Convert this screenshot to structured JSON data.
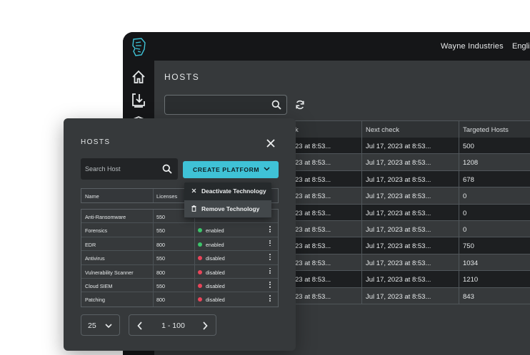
{
  "app": {
    "company": "Wayne Industries",
    "language": "Engli",
    "page_title": "HOSTS",
    "search_placeholder": "",
    "table": {
      "columns": [
        "k",
        "Next check",
        "Targeted Hosts"
      ],
      "rows": [
        {
          "last": "23 at 8:53...",
          "next": "Jul 17, 2023 at 8:53...",
          "hosts": "500"
        },
        {
          "last": "23 at 8:53...",
          "next": "Jul 17, 2023 at 8:53...",
          "hosts": "1208"
        },
        {
          "last": "23 at 8:53...",
          "next": "Jul 17, 2023 at 8:53...",
          "hosts": "678"
        },
        {
          "last": "23 at 8:53...",
          "next": "Jul 17, 2023 at 8:53...",
          "hosts": "0"
        },
        {
          "last": "23 at 8:53...",
          "next": "Jul 17, 2023 at 8:53...",
          "hosts": "0"
        },
        {
          "last": "23 at 8:53...",
          "next": "Jul 17, 2023 at 8:53...",
          "hosts": "0"
        },
        {
          "last": "23 at 8:53...",
          "next": "Jul 17, 2023 at 8:53...",
          "hosts": "750"
        },
        {
          "last": "23 at 8:53...",
          "next": "Jul 17, 2023 at 8:53...",
          "hosts": "1034"
        },
        {
          "last": "23 at 8:53...",
          "next": "Jul 17, 2023 at 8:53...",
          "hosts": "1210"
        },
        {
          "last": "23 at 8:53...",
          "next": "Jul 17, 2023 at 8:53...",
          "hosts": "843"
        }
      ]
    },
    "sidebar_icons": [
      "home-icon",
      "download-icon"
    ]
  },
  "modal": {
    "title": "HOSTS",
    "search_placeholder": "Search Host",
    "create_label": "CREATE PLATFORM",
    "columns": [
      "Name",
      "Licenses"
    ],
    "rows": [
      {
        "name": "Anti-Ransomware",
        "licenses": "550",
        "status": "",
        "status_color": ""
      },
      {
        "name": "Forensics",
        "licenses": "550",
        "status": "enabled",
        "status_color": "#3cc46a"
      },
      {
        "name": "EDR",
        "licenses": "800",
        "status": "enabled",
        "status_color": "#3cc46a"
      },
      {
        "name": "Antivirus",
        "licenses": "550",
        "status": "disabled",
        "status_color": "#e8455a"
      },
      {
        "name": "Vulnerability Scanner",
        "licenses": "800",
        "status": "disabled",
        "status_color": "#e8455a"
      },
      {
        "name": "Cloud SIEM",
        "licenses": "550",
        "status": "disabled",
        "status_color": "#e8455a"
      },
      {
        "name": "Patching",
        "licenses": "800",
        "status": "disabled",
        "status_color": "#e8455a"
      }
    ],
    "context_menu": {
      "deactivate": "Deactivate Technology",
      "remove": "Remove Technology"
    },
    "page_size": "25",
    "page_range": "1 - 100"
  },
  "colors": {
    "accent": "#3fc2d6",
    "enabled": "#3cc46a",
    "disabled": "#e8455a"
  }
}
